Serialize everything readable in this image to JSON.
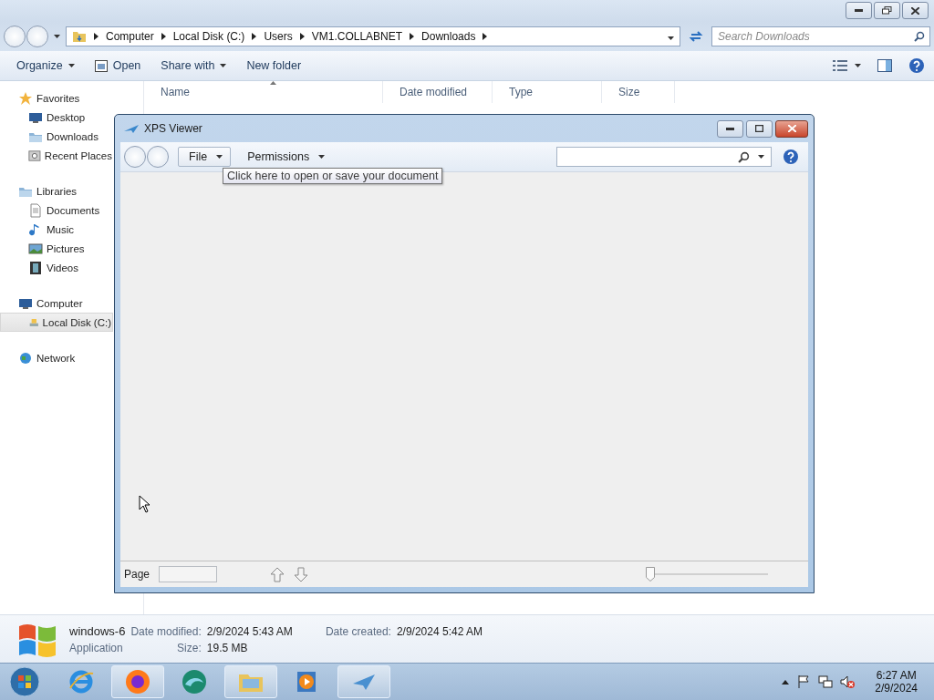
{
  "explorer": {
    "breadcrumb": [
      "Computer",
      "Local Disk (C:)",
      "Users",
      "VM1.COLLABNET",
      "Downloads"
    ],
    "search": {
      "placeholder": "Search Downloads"
    },
    "toolbar": [
      {
        "label": "Organize",
        "kind": "menu"
      },
      {
        "label": "Open",
        "kind": "icon"
      },
      {
        "label": "Share with",
        "kind": "menu"
      },
      {
        "label": "New folder",
        "kind": "plain"
      }
    ],
    "sidebar": [
      {
        "label": "Favorites",
        "selected": false,
        "children": [
          {
            "label": "Desktop",
            "selected": false
          },
          {
            "label": "Downloads",
            "selected": false
          },
          {
            "label": "Recent Places",
            "selected": false
          }
        ]
      },
      {
        "label": "Libraries",
        "selected": false,
        "children": [
          {
            "label": "Documents",
            "selected": false
          },
          {
            "label": "Music",
            "selected": false
          },
          {
            "label": "Pictures",
            "selected": false
          },
          {
            "label": "Videos",
            "selected": false
          }
        ]
      },
      {
        "label": "Computer",
        "selected": false,
        "children": [
          {
            "label": "Local Disk (C:)",
            "selected": true
          }
        ]
      },
      {
        "label": "Network",
        "selected": false
      }
    ],
    "columns": [
      "Name",
      "Date modified",
      "Type",
      "Size"
    ],
    "details": {
      "name": "windows-6",
      "type": "Application",
      "fields": [
        {
          "label": "Date modified:",
          "value": "2/9/2024 5:43 AM"
        },
        {
          "label": "Size:",
          "value": "19.5 MB"
        },
        {
          "label": "Date created:",
          "value": "2/9/2024 5:42 AM"
        }
      ]
    }
  },
  "xps": {
    "title": "XPS Viewer",
    "menus": [
      {
        "label": "File",
        "hovered": true
      },
      {
        "label": "Permissions",
        "hovered": false
      }
    ],
    "tooltip": "Click here to open or save your document",
    "page_label": "Page",
    "zoom": {
      "level": 0
    }
  },
  "taskbar": {
    "apps": [
      {
        "kind": "ie",
        "running": false
      },
      {
        "kind": "firefox",
        "running": true
      },
      {
        "kind": "edge",
        "running": false
      },
      {
        "kind": "explorer",
        "running": true
      },
      {
        "kind": "media",
        "running": false
      },
      {
        "kind": "xps",
        "running": true
      }
    ],
    "time": "6:27 AM",
    "date": "2/9/2024"
  }
}
